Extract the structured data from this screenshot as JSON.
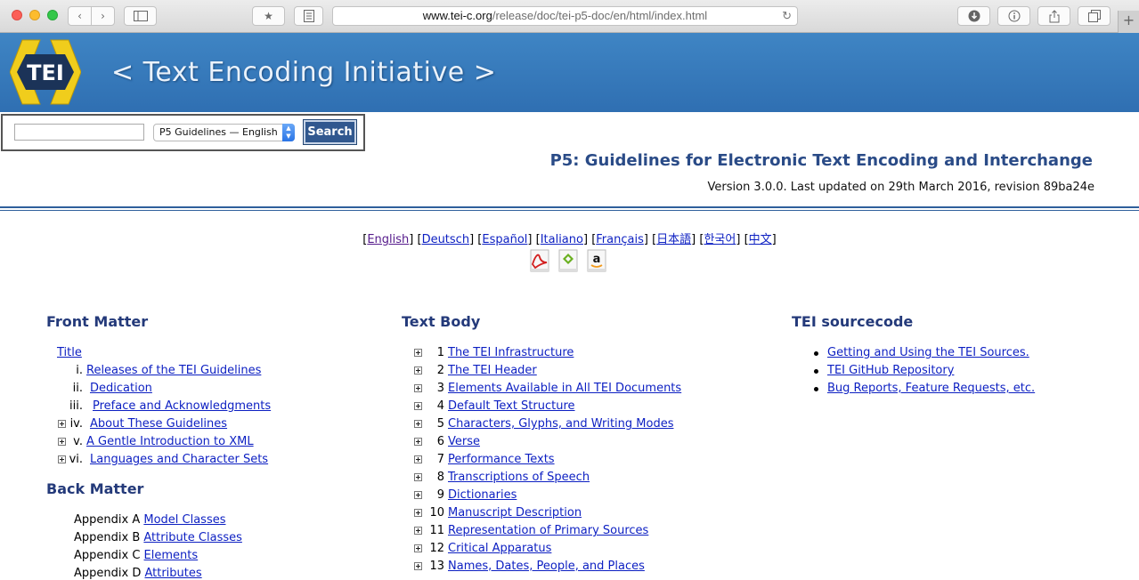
{
  "browser": {
    "url_domain": "www.tei-c.org",
    "url_path": "/release/doc/tei-p5-doc/en/html/index.html",
    "reload_icon": "reload-icon",
    "new_tab_label": "+"
  },
  "banner": {
    "logo_text": "TEI",
    "title": "< Text Encoding Initiative >"
  },
  "search": {
    "input_value": "",
    "select_value": "P5 Guidelines — English",
    "button_label": "Search"
  },
  "header": {
    "title": "P5: Guidelines for Electronic Text Encoding and Interchange",
    "version": "Version 3.0.0. Last updated on 29th March 2016, revision 89ba24e"
  },
  "languages": [
    {
      "label": "English",
      "visited": true
    },
    {
      "label": "Deutsch",
      "visited": false
    },
    {
      "label": "Español",
      "visited": false
    },
    {
      "label": "Italiano",
      "visited": false
    },
    {
      "label": "Français",
      "visited": false
    },
    {
      "label": "日本語",
      "visited": false
    },
    {
      "label": "한국어",
      "visited": false
    },
    {
      "label": "中文",
      "visited": false
    }
  ],
  "format_icons": [
    "pdf-icon",
    "epub-icon",
    "amazon-icon"
  ],
  "front_matter": {
    "heading": "Front Matter",
    "title_link": "Title",
    "items": [
      {
        "num": "i.",
        "label": "Releases of the TEI Guidelines",
        "expandable": false
      },
      {
        "num": "ii.",
        "label": "Dedication",
        "expandable": false
      },
      {
        "num": "iii.",
        "label": "Preface and Acknowledgments",
        "expandable": false
      },
      {
        "num": "iv.",
        "label": "About These Guidelines",
        "expandable": true
      },
      {
        "num": "v.",
        "label": "A Gentle Introduction to XML",
        "expandable": true
      },
      {
        "num": "vi.",
        "label": "Languages and Character Sets",
        "expandable": true
      }
    ]
  },
  "back_matter": {
    "heading": "Back Matter",
    "items": [
      {
        "num": "Appendix A",
        "label": "Model Classes"
      },
      {
        "num": "Appendix B",
        "label": "Attribute Classes"
      },
      {
        "num": "Appendix C",
        "label": "Elements"
      },
      {
        "num": "Appendix D",
        "label": "Attributes"
      }
    ]
  },
  "text_body": {
    "heading": "Text Body",
    "items": [
      {
        "num": "1",
        "label": "The TEI Infrastructure"
      },
      {
        "num": "2",
        "label": "The TEI Header"
      },
      {
        "num": "3",
        "label": "Elements Available in All TEI Documents"
      },
      {
        "num": "4",
        "label": "Default Text Structure"
      },
      {
        "num": "5",
        "label": "Characters, Glyphs, and Writing Modes"
      },
      {
        "num": "6",
        "label": "Verse"
      },
      {
        "num": "7",
        "label": "Performance Texts"
      },
      {
        "num": "8",
        "label": "Transcriptions of Speech"
      },
      {
        "num": "9",
        "label": "Dictionaries"
      },
      {
        "num": "10",
        "label": "Manuscript Description"
      },
      {
        "num": "11",
        "label": "Representation of Primary Sources"
      },
      {
        "num": "12",
        "label": "Critical Apparatus"
      },
      {
        "num": "13",
        "label": "Names, Dates, People, and Places"
      }
    ]
  },
  "sourcecode": {
    "heading": "TEI sourcecode",
    "items": [
      "Getting and Using the TEI Sources.",
      "TEI GitHub Repository",
      "Bug Reports, Feature Requests, etc."
    ]
  }
}
